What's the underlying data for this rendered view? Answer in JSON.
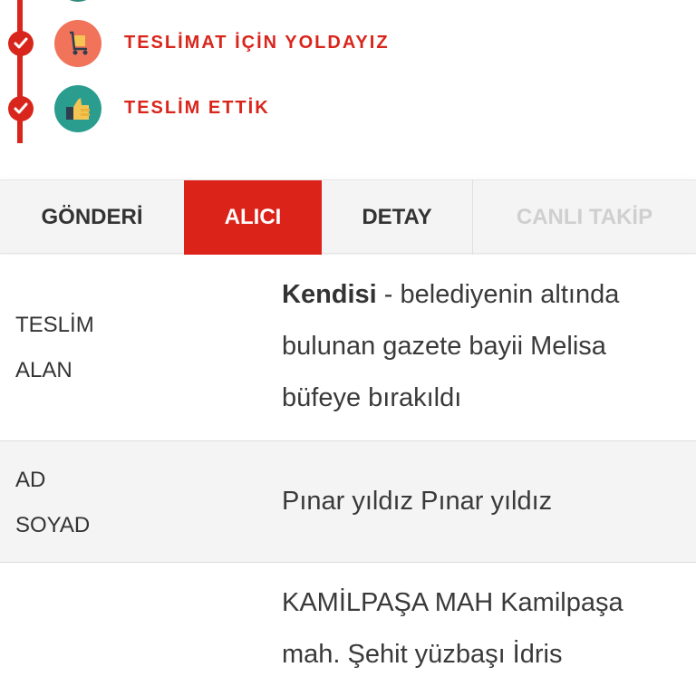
{
  "timeline": {
    "steps": [
      {
        "label": "TESLİMAT İÇİN YOLDAYIZ",
        "icon": "delivery-cart-icon",
        "icon_bg": "#f0735a"
      },
      {
        "label": "TESLİM ETTİK",
        "icon": "thumbs-up-icon",
        "icon_bg": "#2a9d8f"
      }
    ],
    "accent": "#d9261c"
  },
  "tabs": [
    {
      "label": "GÖNDERİ",
      "active": false
    },
    {
      "label": "ALICI",
      "active": true
    },
    {
      "label": "DETAY",
      "active": false
    },
    {
      "label": "CANLI TAKİP",
      "active": false,
      "disabled": true
    }
  ],
  "rows": [
    {
      "label_line1": "TESLİM",
      "label_line2": "ALAN",
      "value_bold": "Kendisi",
      "value_rest": " - belediyenin altında bulunan gazete bayii Melisa büfeye bırakıldı"
    },
    {
      "label_line1": "AD",
      "label_line2": "SOYAD",
      "value": "Pınar yıldız Pınar yıldız"
    },
    {
      "label_line1": "",
      "label_line2": "",
      "value": "KAMİLPAŞA MAH Kamilpaşa mah. Şehit yüzbaşı İdris"
    }
  ]
}
